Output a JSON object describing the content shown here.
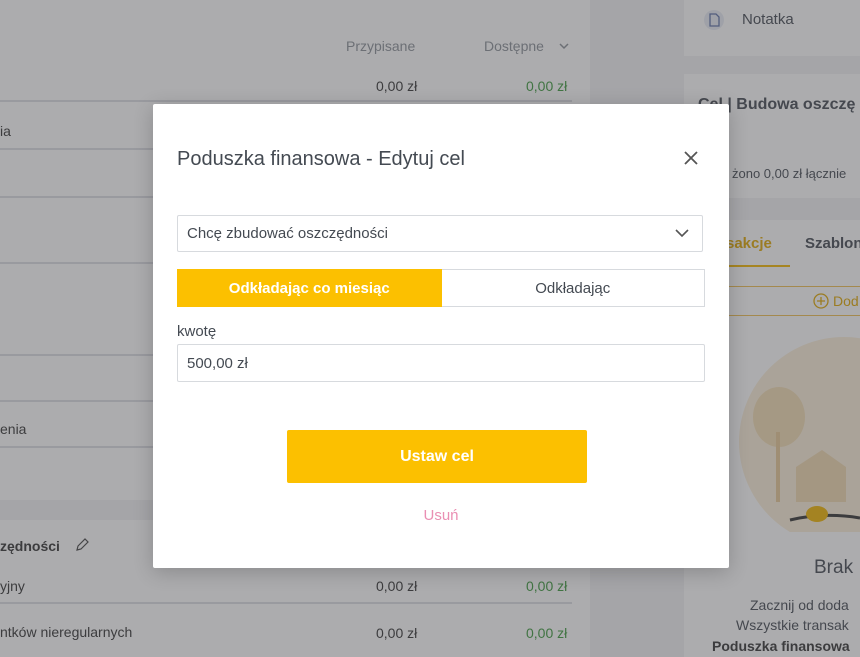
{
  "budget": {
    "col_assigned": "Przypisane",
    "col_available": "Dostępne",
    "top_row": {
      "assigned": "0,00 zł",
      "available": "0,00 zł"
    },
    "partial_rows": [
      "ia",
      "",
      "",
      "",
      "enia"
    ],
    "group_title": "zędności",
    "group_rows": [
      {
        "name": "yjny",
        "assigned": "0,00 zł",
        "available": "0,00 zł"
      },
      {
        "name": "ntków nieregularnych",
        "assigned": "0,00 zł",
        "available": "0,00 zł"
      }
    ]
  },
  "sidebar": {
    "note_label": "Notatka",
    "goal_title": "Cel | Budowa oszczę",
    "goal_sub": "żono 0,00 zł łącznie",
    "tabs": [
      "sakcje",
      "Szablon"
    ],
    "add_label": "Dod",
    "empty_title": "Brak",
    "empty_line1": "Zacznij od doda",
    "empty_line2": "Wszystkie transak",
    "empty_line3": "Poduszka finansowa"
  },
  "modal": {
    "title": "Poduszka finansowa - Edytuj cel",
    "goal_type": "Chcę zbudować oszczędności",
    "toggle": [
      "Odkładając co miesiąc",
      "Odkładając"
    ],
    "amount_label": "kwotę",
    "amount_value": "500,00 zł",
    "submit_label": "Ustaw cel",
    "delete_label": "Usuń"
  },
  "colors": {
    "accent": "#fcc000",
    "delete": "#ea8fb3",
    "positive": "#3c9a3c"
  }
}
